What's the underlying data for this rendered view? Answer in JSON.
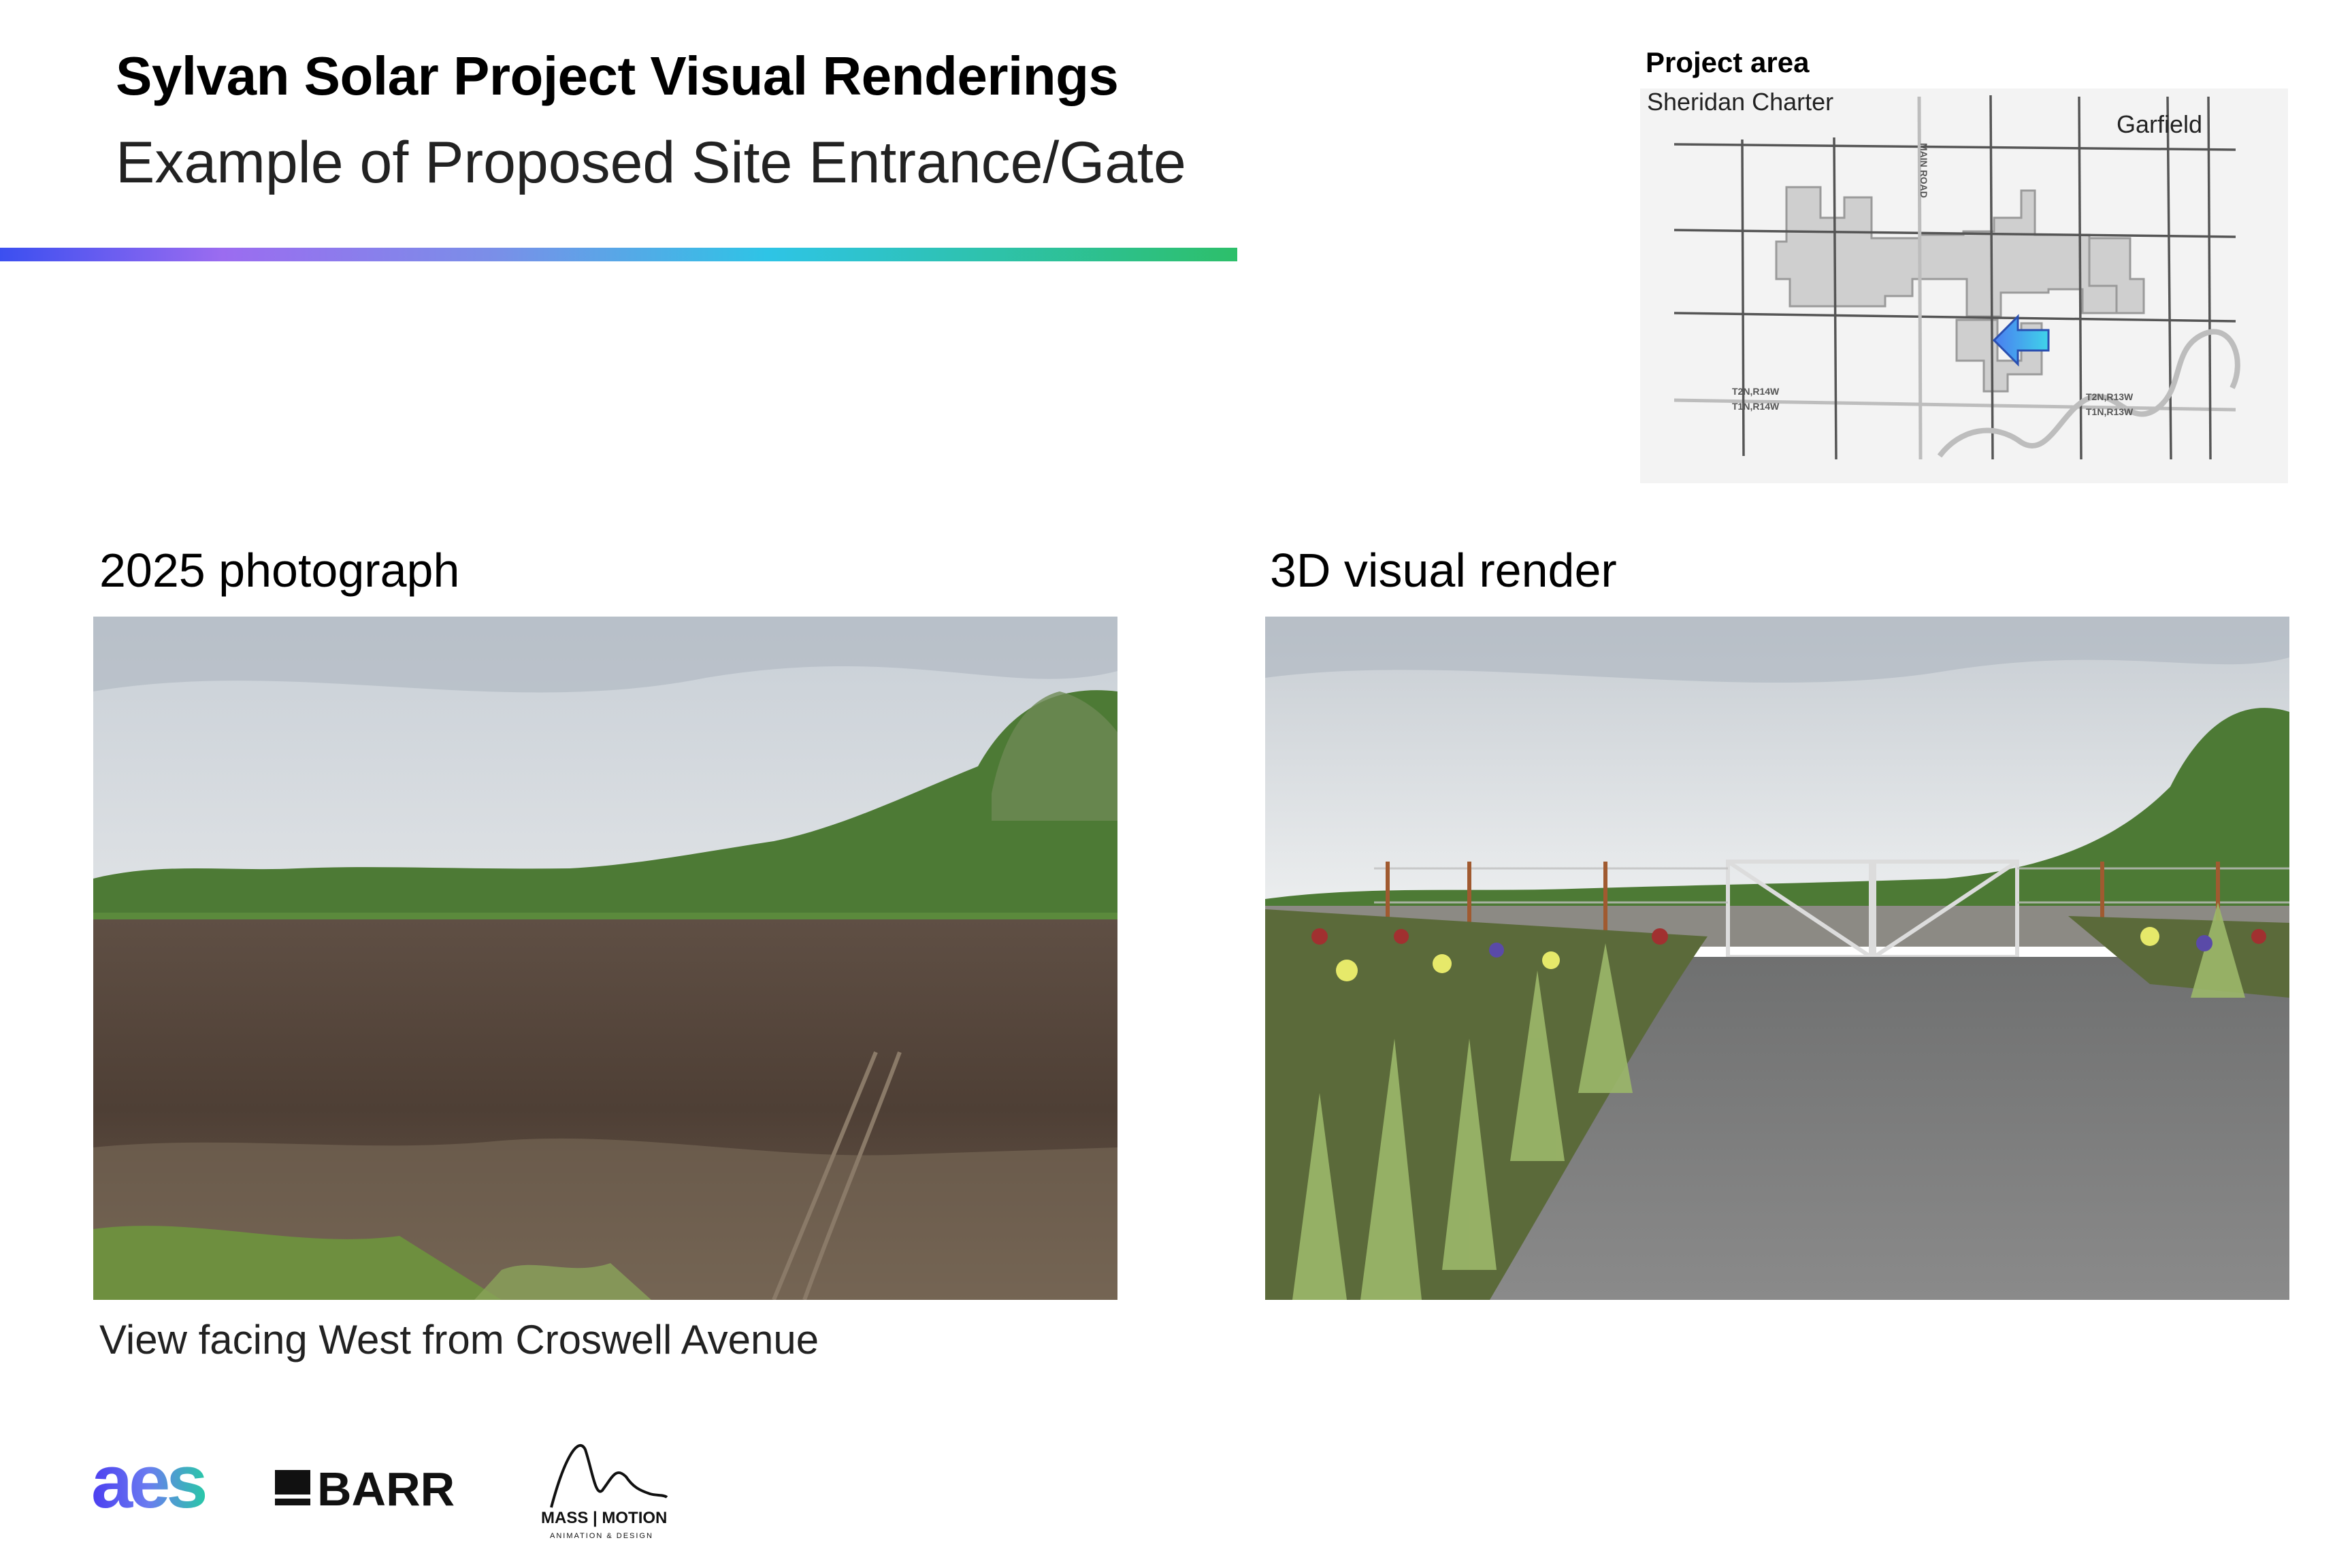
{
  "header": {
    "title": "Sylvan Solar Project Visual Renderings",
    "subtitle": "Example of Proposed Site Entrance/Gate"
  },
  "map": {
    "label": "Project area",
    "places": {
      "sheridan": "Sheridan Charter",
      "garfield": "Garfield"
    },
    "road_label": "MAIN ROAD",
    "township_labels": [
      "T2N,R14W",
      "T1N,R14W",
      "T2N,R13W",
      "T1N,R13W"
    ],
    "arrow_color": "#3fa9f5",
    "project_fill": "#cfcfcf"
  },
  "panels": {
    "left": {
      "label": "2025 photograph",
      "caption": "View facing West from Croswell Avenue"
    },
    "right": {
      "label": "3D visual render"
    }
  },
  "logos": {
    "aes": "aes",
    "barr": "BARR",
    "mass_motion": "MASS | MOTION",
    "mass_motion_sub": "ANIMATION & DESIGN"
  },
  "colors": {
    "gradient_start": "#3b4ff0",
    "gradient_mid": "#2ec4e6",
    "gradient_end": "#2dbf6a"
  }
}
